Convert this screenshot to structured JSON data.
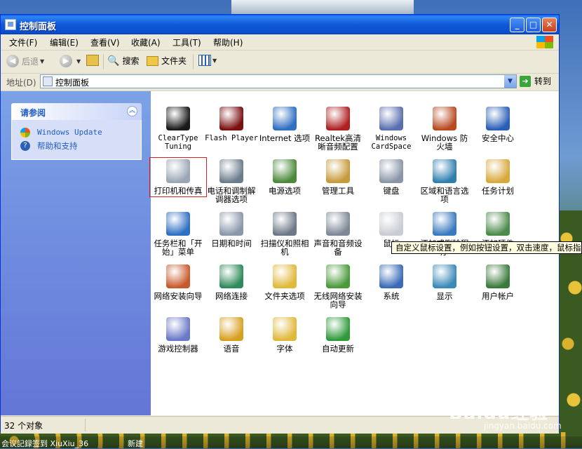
{
  "window": {
    "title": "控制面板"
  },
  "title_buttons": {
    "minimize": "_",
    "maximize": "□",
    "close": "✕"
  },
  "menu": [
    {
      "label": "文件(F)"
    },
    {
      "label": "编辑(E)"
    },
    {
      "label": "查看(V)"
    },
    {
      "label": "收藏(A)"
    },
    {
      "label": "工具(T)"
    },
    {
      "label": "帮助(H)"
    }
  ],
  "toolbar": {
    "back": "后退",
    "search": "搜索",
    "folders": "文件夹"
  },
  "address": {
    "label": "地址(D)",
    "value": "控制面板",
    "go": "转到"
  },
  "taskpane": {
    "header": "请参阅",
    "links": [
      {
        "label": "Windows Update",
        "icon": "windows-update-icon"
      },
      {
        "label": "帮助和支持",
        "icon": "help-icon"
      }
    ]
  },
  "items": [
    {
      "label": "ClearType Tuning",
      "icon": "cleartype-icon",
      "color": "#1a1a1a"
    },
    {
      "label": "Flash Player",
      "icon": "flash-icon",
      "color": "#7a1010"
    },
    {
      "label": "Internet 选项",
      "icon": "globe-icon",
      "color": "#2e6fc2"
    },
    {
      "label": "Realtek高清晰音频配置",
      "icon": "speaker-icon",
      "color": "#b02020"
    },
    {
      "label": "Windows CardSpace",
      "icon": "cards-icon",
      "color": "#5a6fb0"
    },
    {
      "label": "Windows 防火墙",
      "icon": "firewall-icon",
      "color": "#b84a20"
    },
    {
      "label": "安全中心",
      "icon": "shield-icon",
      "color": "#2a5fb8"
    },
    {
      "label": "打印机和传真",
      "icon": "printer-icon",
      "color": "#9aa6b4"
    },
    {
      "label": "电话和调制解调器选项",
      "icon": "phone-icon",
      "color": "#6b7d8c"
    },
    {
      "label": "电源选项",
      "icon": "power-icon",
      "color": "#4b8a3a"
    },
    {
      "label": "管理工具",
      "icon": "admin-tools-icon",
      "color": "#c79a3a"
    },
    {
      "label": "键盘",
      "icon": "keyboard-icon",
      "color": "#8a96a8"
    },
    {
      "label": "区域和语言选项",
      "icon": "globe-stand-icon",
      "color": "#2e7fb0"
    },
    {
      "label": "任务计划",
      "icon": "scheduler-icon",
      "color": "#d8a83a"
    },
    {
      "label": "任务栏和「开始」菜单",
      "icon": "taskbar-icon",
      "color": "#2e6fc2"
    },
    {
      "label": "日期和时间",
      "icon": "clock-icon",
      "color": "#8a97aa"
    },
    {
      "label": "扫描仪和照相机",
      "icon": "scanner-icon",
      "color": "#6c7886"
    },
    {
      "label": "声音和音频设备",
      "icon": "sound-icon",
      "color": "#7d8796"
    },
    {
      "label": "鼠标",
      "icon": "mouse-icon",
      "color": "#c9ccd2"
    },
    {
      "label": "添加或删除程序",
      "icon": "add-remove-icon",
      "color": "#3a7ac0"
    },
    {
      "label": "添加硬件",
      "icon": "hardware-icon",
      "color": "#4a8a4a"
    },
    {
      "label": "网络安装向导",
      "icon": "home-network-icon",
      "color": "#c85a2a"
    },
    {
      "label": "网络连接",
      "icon": "network-icon",
      "color": "#2e8a5a"
    },
    {
      "label": "文件夹选项",
      "icon": "folder-options-icon",
      "color": "#e0b83a"
    },
    {
      "label": "无线网络安装向导",
      "icon": "wireless-icon",
      "color": "#4a9a3a"
    },
    {
      "label": "系统",
      "icon": "system-icon",
      "color": "#3a6ab8"
    },
    {
      "label": "显示",
      "icon": "display-icon",
      "color": "#3a8ab8"
    },
    {
      "label": "用户帐户",
      "icon": "users-icon",
      "color": "#3a7a3a"
    },
    {
      "label": "游戏控制器",
      "icon": "gamepad-icon",
      "color": "#6a78c8"
    },
    {
      "label": "语音",
      "icon": "speech-icon",
      "color": "#d8a020"
    },
    {
      "label": "字体",
      "icon": "fonts-icon",
      "color": "#e0b83a"
    },
    {
      "label": "自动更新",
      "icon": "auto-update-icon",
      "color": "#2e9a3a"
    }
  ],
  "tooltip": "自定义鼠标设置，例如按钮设置，双击速度，鼠标指",
  "status": {
    "count": "32 个对象"
  },
  "taskbar": {
    "left": "会议記録签到 XiuXiu_36",
    "right": "新建"
  },
  "watermark": {
    "brand": "Baidu经验",
    "url": "jingyan.baidu.com"
  }
}
